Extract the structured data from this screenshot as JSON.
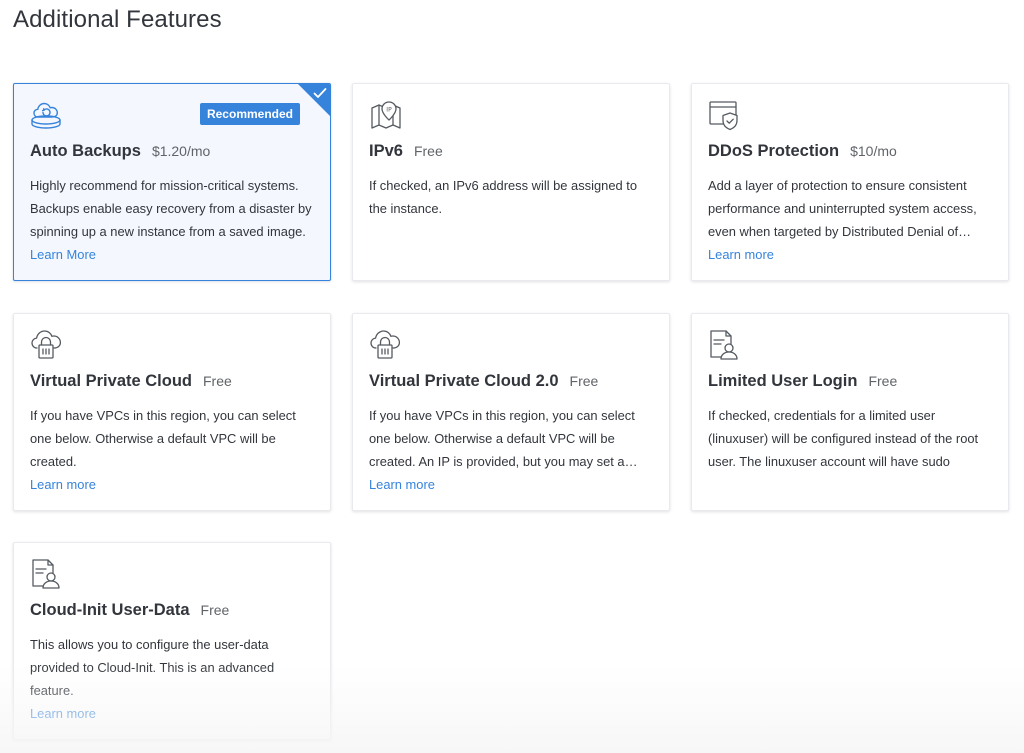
{
  "page": {
    "title": "Additional Features"
  },
  "colors": {
    "accent": "#3683dc",
    "selected_bg": "#f4f8fe",
    "text": "#32363c",
    "muted": "#606469"
  },
  "cards": [
    {
      "name": "Auto Backups",
      "price": "$1.20/mo",
      "description": "Highly recommend for mission-critical systems. Backups enable easy recovery from a disaster by spinning up a new instance from a saved image.",
      "learn_label": "Learn More",
      "badge": "Recommended",
      "selected": true,
      "icon": "cloud-backup-icon"
    },
    {
      "name": "IPv6",
      "price": "Free",
      "description": "If checked, an IPv6 address will be assigned to the instance.",
      "learn_label": "",
      "selected": false,
      "icon": "ip-location-icon"
    },
    {
      "name": "DDoS Protection",
      "price": "$10/mo",
      "description": "Add a layer of protection to ensure consistent performance and uninterrupted system access, even when targeted by Distributed Denial of Service…",
      "learn_label": "Learn more",
      "selected": false,
      "icon": "shield-window-icon"
    },
    {
      "name": "Virtual Private Cloud",
      "price": "Free",
      "description": "If you have VPCs in this region, you can select one below. Otherwise a default VPC will be created.",
      "learn_label": "Learn more",
      "selected": false,
      "icon": "cloud-lock-icon"
    },
    {
      "name": "Virtual Private Cloud 2.0",
      "price": "Free",
      "description": "If you have VPCs in this region, you can select one below. Otherwise a default VPC will be created. An IP is provided, but you may set a different IP if…",
      "learn_label": "Learn more",
      "selected": false,
      "icon": "cloud-lock-icon"
    },
    {
      "name": "Limited User Login",
      "price": "Free",
      "description": "If checked, credentials for a limited user (linuxuser) will be configured instead of the root user. The linuxuser account will have sudo access.",
      "learn_label": "",
      "selected": false,
      "icon": "user-document-icon"
    },
    {
      "name": "Cloud-Init User-Data",
      "price": "Free",
      "description": "This allows you to configure the user-data provided to Cloud-Init. This is an advanced feature.",
      "learn_label": "Learn more",
      "selected": false,
      "icon": "user-document-icon"
    }
  ]
}
